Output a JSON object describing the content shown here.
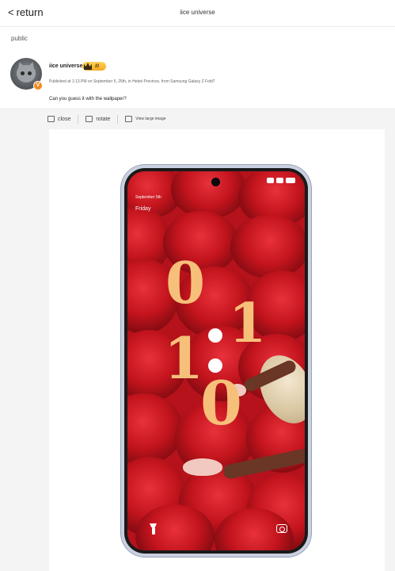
{
  "header": {
    "back_label": "return",
    "back_glyph": "<",
    "title": "iice universe"
  },
  "visibility": "public",
  "post": {
    "username": "iice universe",
    "level": "III",
    "meta": "Published at 1:13 PM on September 5, 25th, in Hebei Province, from Samsung Galaxy Z Fold7",
    "text": "Can you guess it with the wallpaper?",
    "verified_mark": "V"
  },
  "toolbar": {
    "close_label": "close",
    "rotate_label": "rotate",
    "large_image_label": "View large image"
  },
  "lockscreen": {
    "date": "September 5th",
    "day": "Friday",
    "hour_1": "0",
    "hour_2": "1",
    "minute_1": "1",
    "minute_2": "0",
    "clock_color": "#f7c07a"
  },
  "colors": {
    "badge_orange": "#f08a1c",
    "level_gold": "#f3a921",
    "wallpaper_red": "#c3141d"
  }
}
